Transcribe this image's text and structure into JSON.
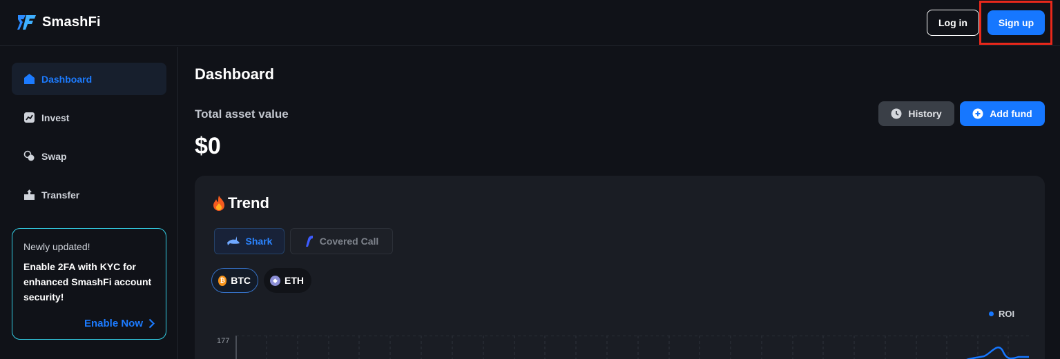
{
  "brand": {
    "name": "SmashFi",
    "primary": "#1677ff",
    "promo_border": "#34d1e8"
  },
  "header": {
    "login_label": "Log in",
    "signup_label": "Sign up"
  },
  "sidebar": {
    "items": [
      {
        "label": "Dashboard",
        "icon": "home-icon",
        "active": true
      },
      {
        "label": "Invest",
        "icon": "chart-icon",
        "active": false
      },
      {
        "label": "Swap",
        "icon": "swap-icon",
        "active": false
      },
      {
        "label": "Transfer",
        "icon": "transfer-icon",
        "active": false
      }
    ],
    "promo": {
      "title": "Newly updated!",
      "body": "Enable 2FA with KYC for enhanced SmashFi account security!",
      "cta": "Enable Now"
    }
  },
  "main": {
    "title": "Dashboard",
    "asset_label": "Total asset value",
    "asset_value": "$0",
    "history_label": "History",
    "add_fund_label": "Add fund",
    "trend": {
      "title": "Trend",
      "tabs": [
        {
          "label": "Shark",
          "active": true
        },
        {
          "label": "Covered Call",
          "active": false
        }
      ],
      "coins": [
        {
          "label": "BTC",
          "active": true
        },
        {
          "label": "ETH",
          "active": false
        }
      ],
      "legend": "ROI",
      "y_tick": "177"
    }
  }
}
